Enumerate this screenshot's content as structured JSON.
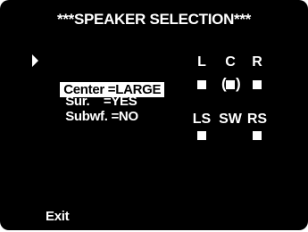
{
  "screen": {
    "title": "***SPEAKER SELECTION***",
    "menu": [
      {
        "label": "Center =LARGE",
        "selected": true
      },
      {
        "label": "Sur.    =YES",
        "selected": false
      },
      {
        "label": "Subwf. =NO",
        "selected": false
      }
    ],
    "channels": {
      "L": {
        "label": "L",
        "enabled": true
      },
      "C": {
        "label": "C",
        "enabled": true,
        "indicator": "(■)"
      },
      "R": {
        "label": "R",
        "enabled": true
      },
      "LS": {
        "label": "LS",
        "enabled": true
      },
      "SW": {
        "label": "SW",
        "enabled": false
      },
      "RS": {
        "label": "RS",
        "enabled": true
      }
    },
    "exit_label": "Exit"
  },
  "colors": {
    "background": "#000000",
    "foreground": "#ffffff",
    "highlight_text": "#000000"
  }
}
